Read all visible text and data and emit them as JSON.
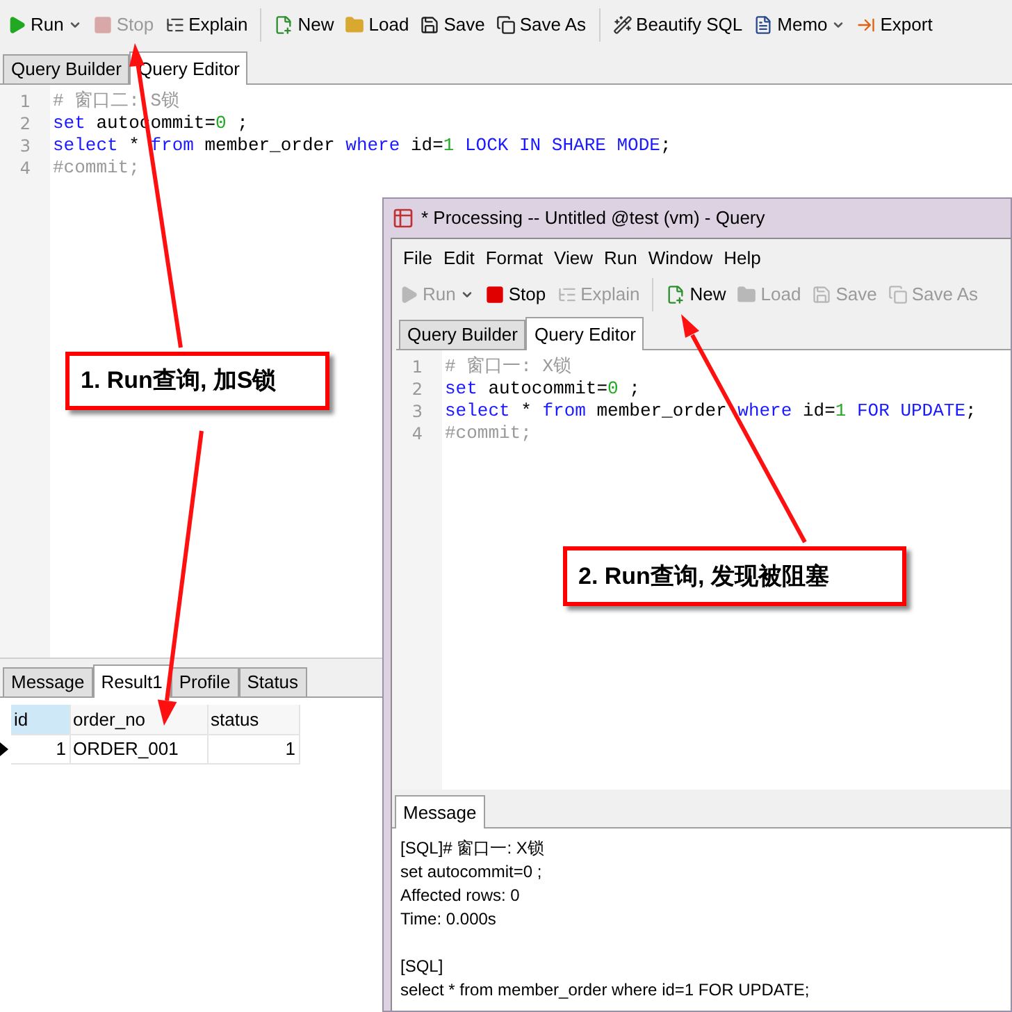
{
  "main_window": {
    "toolbar": [
      [
        {
          "kind": "run",
          "label": "Run",
          "disabled": false,
          "dropdown": true
        },
        {
          "kind": "stop",
          "label": "Stop",
          "disabled": true,
          "dropdown": false
        },
        {
          "kind": "explain",
          "label": "Explain",
          "disabled": false,
          "dropdown": false
        }
      ],
      [
        {
          "kind": "new",
          "label": "New",
          "disabled": false,
          "dropdown": false
        },
        {
          "kind": "load",
          "label": "Load",
          "disabled": false,
          "dropdown": false
        },
        {
          "kind": "save",
          "label": "Save",
          "disabled": false,
          "dropdown": false
        },
        {
          "kind": "save_as",
          "label": "Save As",
          "disabled": false,
          "dropdown": false
        }
      ],
      [
        {
          "kind": "beautify",
          "label": "Beautify SQL",
          "disabled": false,
          "dropdown": false
        },
        {
          "kind": "memo",
          "label": "Memo",
          "disabled": false,
          "dropdown": true
        },
        {
          "kind": "export",
          "label": "Export",
          "disabled": false,
          "dropdown": false
        }
      ]
    ],
    "tabs": [
      {
        "label": "Query Builder",
        "selected": false
      },
      {
        "label": "Query Editor",
        "selected": true
      }
    ],
    "editor": [
      {
        "number": "1",
        "tokens": [
          {
            "kind": "comment",
            "text": "# 窗口二: S锁"
          }
        ]
      },
      {
        "number": "2",
        "tokens": [
          {
            "kind": "keyword",
            "text": "set"
          },
          {
            "kind": "plain",
            "text": " autocommit="
          },
          {
            "kind": "number",
            "text": "0"
          },
          {
            "kind": "plain",
            "text": " ;"
          }
        ]
      },
      {
        "number": "3",
        "tokens": [
          {
            "kind": "keyword",
            "text": "select"
          },
          {
            "kind": "plain",
            "text": " * "
          },
          {
            "kind": "keyword",
            "text": "from"
          },
          {
            "kind": "plain",
            "text": " member_order "
          },
          {
            "kind": "keyword",
            "text": "where"
          },
          {
            "kind": "plain",
            "text": " id="
          },
          {
            "kind": "number",
            "text": "1"
          },
          {
            "kind": "keyword",
            "text": " LOCK IN SHARE MODE"
          },
          {
            "kind": "plain",
            "text": ";"
          }
        ]
      },
      {
        "number": "4",
        "tokens": [
          {
            "kind": "comment",
            "text": "#commit;"
          }
        ]
      }
    ],
    "result_tabs": [
      {
        "label": "Message",
        "selected": false
      },
      {
        "label": "Result1",
        "selected": true
      },
      {
        "label": "Profile",
        "selected": false
      },
      {
        "label": "Status",
        "selected": false
      }
    ],
    "table": {
      "columns": [
        {
          "label": "id",
          "highlighted": true
        },
        {
          "label": "order_no",
          "highlighted": false
        },
        {
          "label": "status",
          "highlighted": false
        }
      ],
      "rows": [
        {
          "selected": true,
          "cells": [
            "1",
            "ORDER_001",
            "1"
          ]
        }
      ]
    }
  },
  "query_window": {
    "title": "* Processing -- Untitled @test (vm) - Query",
    "menu": [
      "File",
      "Edit",
      "Format",
      "View",
      "Run",
      "Window",
      "Help"
    ],
    "toolbar": [
      [
        {
          "kind": "run",
          "label": "Run",
          "disabled": true,
          "dropdown": true
        },
        {
          "kind": "stop",
          "label": "Stop",
          "disabled": false,
          "dropdown": false
        },
        {
          "kind": "explain",
          "label": "Explain",
          "disabled": true,
          "dropdown": false
        }
      ],
      [
        {
          "kind": "new",
          "label": "New",
          "disabled": false,
          "dropdown": false
        },
        {
          "kind": "load",
          "label": "Load",
          "disabled": true,
          "dropdown": false
        },
        {
          "kind": "save",
          "label": "Save",
          "disabled": true,
          "dropdown": false
        },
        {
          "kind": "save_as",
          "label": "Save As",
          "disabled": true,
          "dropdown": false
        }
      ]
    ],
    "tabs": [
      {
        "label": "Query Builder",
        "selected": false
      },
      {
        "label": "Query Editor",
        "selected": true
      }
    ],
    "editor": [
      {
        "number": "1",
        "tokens": [
          {
            "kind": "comment",
            "text": "# 窗口一: X锁"
          }
        ]
      },
      {
        "number": "2",
        "tokens": [
          {
            "kind": "keyword",
            "text": "set"
          },
          {
            "kind": "plain",
            "text": " autocommit="
          },
          {
            "kind": "number",
            "text": "0"
          },
          {
            "kind": "plain",
            "text": " ;"
          }
        ]
      },
      {
        "number": "3",
        "tokens": [
          {
            "kind": "keyword",
            "text": "select"
          },
          {
            "kind": "plain",
            "text": " * "
          },
          {
            "kind": "keyword",
            "text": "from"
          },
          {
            "kind": "plain",
            "text": " member_order "
          },
          {
            "kind": "keyword",
            "text": "where"
          },
          {
            "kind": "plain",
            "text": " id="
          },
          {
            "kind": "number",
            "text": "1"
          },
          {
            "kind": "keyword",
            "text": " FOR UPDATE"
          },
          {
            "kind": "plain",
            "text": ";"
          }
        ]
      },
      {
        "number": "4",
        "tokens": [
          {
            "kind": "comment",
            "text": "#commit;"
          }
        ]
      }
    ],
    "message_tabs": [
      {
        "label": "Message",
        "selected": true
      }
    ],
    "messages": [
      [
        "[SQL]# 窗口一: X锁",
        "set autocommit=0 ;",
        "Affected rows: 0",
        "Time: 0.000s"
      ],
      [
        "[SQL]",
        "select * from member_order where id=1 FOR UPDATE;"
      ]
    ]
  },
  "callouts": [
    "1. Run查询, 加S锁",
    "2. Run查询, 发现被阻塞"
  ]
}
